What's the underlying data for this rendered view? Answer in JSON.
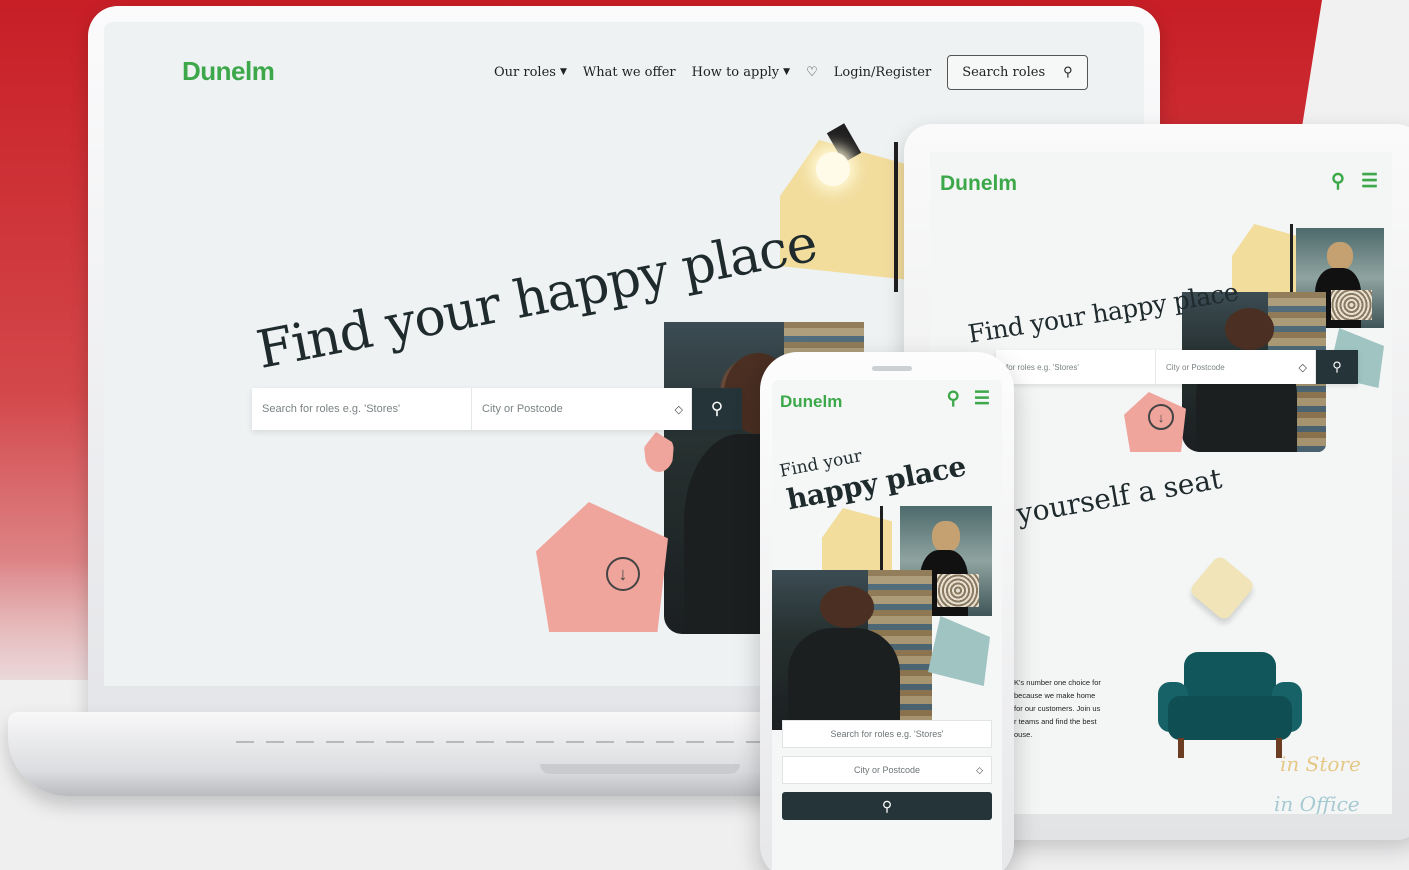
{
  "brand": {
    "logo_text": "Dunelm",
    "accent_color": "#3da84a",
    "dark_button_color": "#243438",
    "background_red": "#c81e26"
  },
  "laptop": {
    "nav": {
      "our_roles": "Our roles",
      "what_we_offer": "What we offer",
      "how_to_apply": "How to apply",
      "favourites_icon": "heart-icon",
      "login_register": "Login/Register",
      "search_roles": "Search roles"
    },
    "hero": {
      "title": "Find your happy place",
      "search_placeholder": "Search for roles e.g. 'Stores'",
      "location_placeholder": "City or Postcode"
    }
  },
  "tablet": {
    "hero": {
      "title": "Find your happy place",
      "search_placeholder": "for roles e.g. 'Stores'",
      "location_placeholder": "City or Postcode"
    },
    "section_title": "yourself a seat",
    "body_lines": [
      "K's number one choice for",
      "because we make home",
      "for our customers. Join us",
      "r teams and find the best",
      "ouse."
    ],
    "in_store": "in Store",
    "in_office": "in Office"
  },
  "phone": {
    "hero_line1": "Find your",
    "hero_line2": "happy place",
    "search_placeholder": "Search for roles e.g. 'Stores'",
    "location_placeholder": "City or Postcode"
  }
}
